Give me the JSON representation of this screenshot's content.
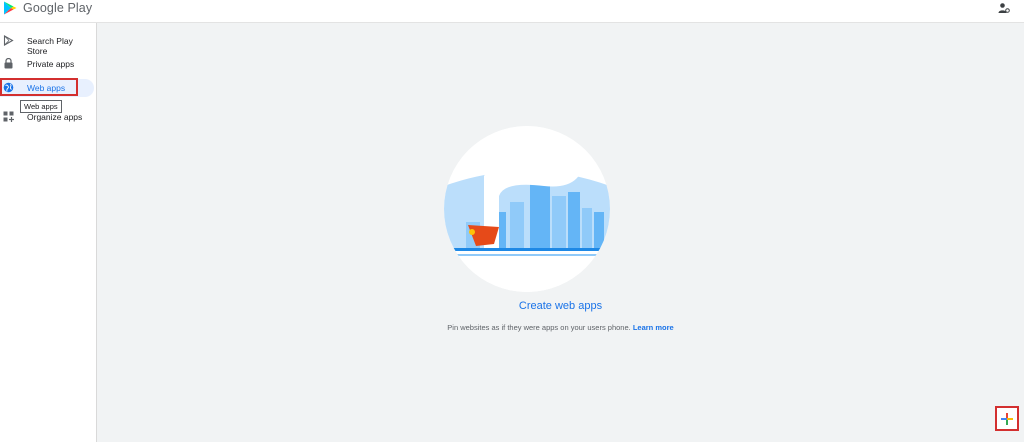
{
  "header": {
    "brand": "Google Play",
    "account_icon": "account-settings-icon"
  },
  "sidebar": {
    "items": [
      {
        "label": "Search Play Store",
        "icon": "play-store-icon"
      },
      {
        "label": "Private apps",
        "icon": "lock-icon"
      },
      {
        "label": "Web apps",
        "icon": "globe-icon",
        "active": true
      },
      {
        "label": "Organize apps",
        "icon": "grid-plus-icon"
      }
    ],
    "tooltip": "Web apps"
  },
  "main": {
    "title": "Create web apps",
    "subtitle": "Pin websites as if they were apps on your users phone.",
    "learn_more": "Learn more",
    "fab_icon": "add-icon"
  },
  "colors": {
    "accent": "#1a73e8",
    "highlight": "#d32f2f",
    "background": "#f1f3f4"
  }
}
